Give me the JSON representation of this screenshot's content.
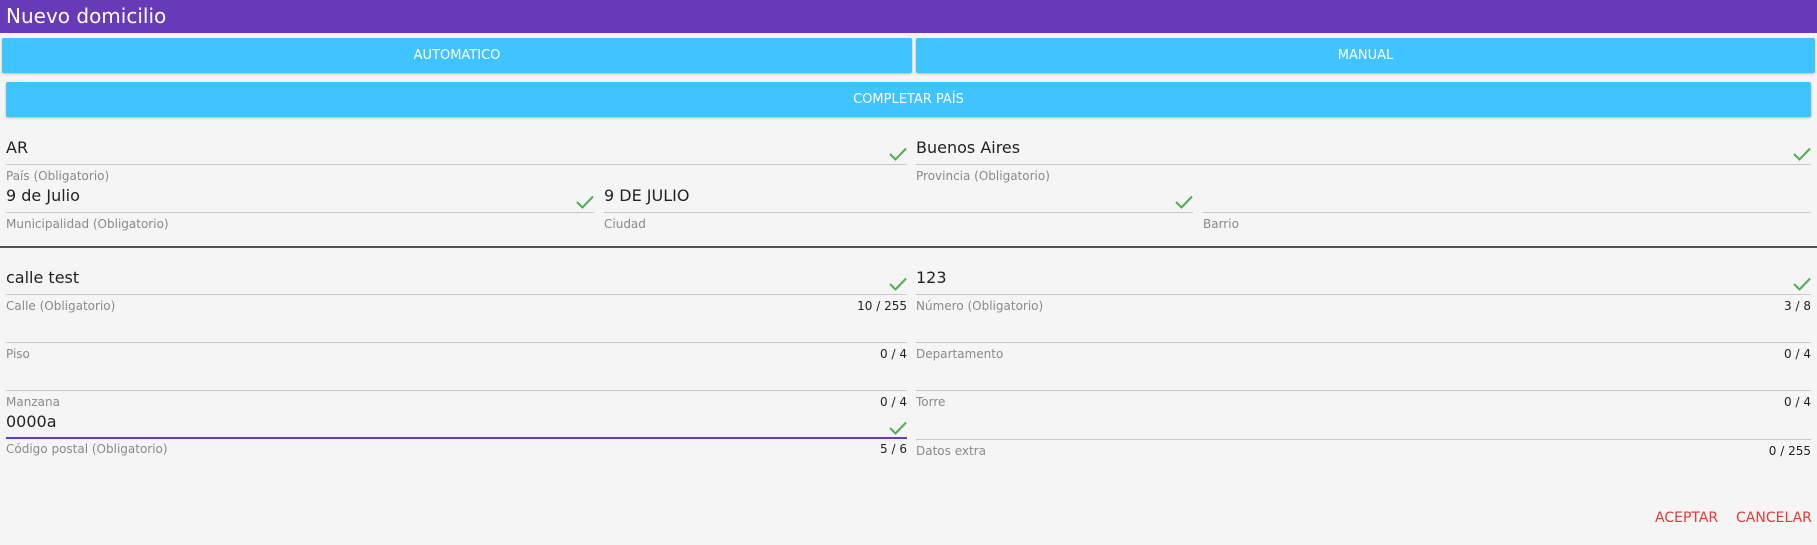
{
  "window": {
    "title": "Nuevo domicilio"
  },
  "mode_buttons": {
    "automatic": "AUTOMATICO",
    "manual": "MANUAL",
    "complete_country": "COMPLETAR PAÍS"
  },
  "location": {
    "pais": {
      "value": "AR",
      "label": "País (Obligatorio)",
      "valid": true
    },
    "provincia": {
      "value": "Buenos Aires",
      "label": "Provincia (Obligatorio)",
      "valid": true
    },
    "municipalidad": {
      "value": "9 de Julio",
      "label": "Municipalidad (Obligatorio)",
      "valid": true
    },
    "ciudad": {
      "value": "9 DE JULIO",
      "label": "Ciudad",
      "valid": true
    },
    "barrio": {
      "value": "",
      "label": "Barrio"
    }
  },
  "address": {
    "calle": {
      "value": "calle test",
      "label": "Calle (Obligatorio)",
      "counter": "10 / 255",
      "valid": true
    },
    "numero": {
      "value": "123",
      "label": "Número (Obligatorio)",
      "counter": "3 / 8",
      "valid": true
    },
    "piso": {
      "value": "",
      "label": "Piso",
      "counter": "0 / 4"
    },
    "departamento": {
      "value": "",
      "label": "Departamento",
      "counter": "0 / 4"
    },
    "manzana": {
      "value": "",
      "label": "Manzana",
      "counter": "0 / 4"
    },
    "torre": {
      "value": "",
      "label": "Torre",
      "counter": "0 / 4"
    },
    "codigo_postal": {
      "value": "0000a",
      "label": "Código postal (Obligatorio)",
      "counter": "5 / 6",
      "valid": true
    },
    "datos_extra": {
      "value": "",
      "label": "Datos extra",
      "counter": "0 / 255"
    }
  },
  "actions": {
    "accept": "ACEPTAR",
    "cancel": "CANCELAR"
  },
  "colors": {
    "header": "#673ab7",
    "button": "#40c4ff",
    "valid": "#4caf50",
    "action": "#e53935",
    "focus": "#673ab7"
  }
}
